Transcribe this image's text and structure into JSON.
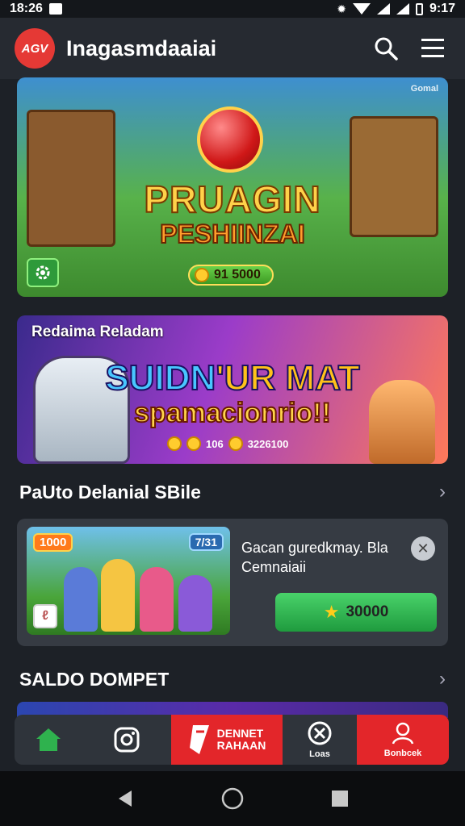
{
  "status_bar": {
    "time": "18:26",
    "right_text": "9:17"
  },
  "app_bar": {
    "logo_text": "AGV",
    "title": "Inagasmdaaiai"
  },
  "banner1": {
    "corner_tag": "Gomal",
    "headline_1": "PRUAGIN",
    "headline_2": "PESHIINZAI",
    "coin_value": "91 5000"
  },
  "banner2": {
    "small_title": "Redaima Reladam",
    "headline_1a": "SUIDN",
    "headline_1b": "'UR MAT",
    "headline_2": "spamacionrio!!",
    "nums_a": "106",
    "nums_b": "3226100"
  },
  "section1": {
    "label": "PaUto Delanial SBile"
  },
  "card": {
    "badge_left": "1000",
    "badge_right": "7/31",
    "title": "Gacan guredkmay. Bla Cemnaiaii",
    "button_label": "30000"
  },
  "section2": {
    "label": "SALDO DOMPET"
  },
  "tabbar": {
    "promo_line1": "DENNET",
    "promo_line2": "RAHAAN",
    "x_label": "Loas",
    "account_label": "Bonbcek"
  },
  "colors": {
    "accent_red": "#e3262a",
    "accent_green": "#2fb24e",
    "bg": "#1d2127"
  }
}
